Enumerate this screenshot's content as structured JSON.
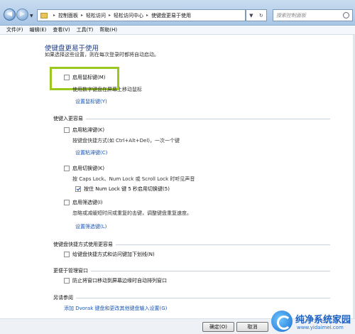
{
  "address": {
    "crumbs": [
      "控制面板",
      "轻松访问",
      "轻松访问中心",
      "使键盘更易于使用"
    ],
    "search_placeholder": "搜索控制面板"
  },
  "menu": [
    "文件(F)",
    "编辑(E)",
    "查看(V)",
    "工具(T)",
    "帮助(H)"
  ],
  "page": {
    "title": "使键盘更易于使用",
    "description": "如果选择这些设置，则在每次登录时都将自动启动。"
  },
  "section_mouse": {
    "option": "启用鼠标键(M)",
    "checked": false,
    "note": "使用数字键盘在屏幕上移动鼠标",
    "link": "设置鼠标键(Y)"
  },
  "section_typing": {
    "heading": "使键入更容易",
    "sticky": {
      "label": "启用粘滞键(K)",
      "checked": false,
      "note": "按键盘快捷方式(如 Ctrl+Alt+Del)，一次一个键",
      "link": "设置粘滞键(C)"
    },
    "toggle": {
      "label": "启用切换键(K)",
      "checked": false,
      "note": "按 Caps Lock、Num Lock 或 Scroll Lock 时听见声音",
      "sub_label": "按住 Num Lock 键 5 秒启用切换键(5)",
      "sub_checked": true
    },
    "filter": {
      "label": "启用筛选键(I)",
      "checked": false,
      "note": "忽略或减缓短时间或重复的击键，调整键盘重复速度。",
      "link": "设置筛选键(L)"
    }
  },
  "section_shortcuts": {
    "heading": "使键盘快捷方式使用更容易",
    "option": "给键盘快捷方式和访问键加下划线(N)",
    "checked": false
  },
  "section_windows": {
    "heading": "更便于管理窗口",
    "option": "防止将窗口移动到屏幕边缘时自动排列窗口",
    "checked": false
  },
  "section_see_also": {
    "heading": "另请参阅",
    "link": "添加 Dvorak 键盘和更改其他键盘输入设置(G)"
  },
  "buttons": {
    "ok": "确定(O)",
    "cancel": "取消"
  },
  "watermark": {
    "name": "纯净系统家园",
    "url": "www.yidaimei.com"
  },
  "colors": {
    "highlight_box": "#9bc81e",
    "link": "#1a56b5",
    "title": "#1e3f8a"
  }
}
